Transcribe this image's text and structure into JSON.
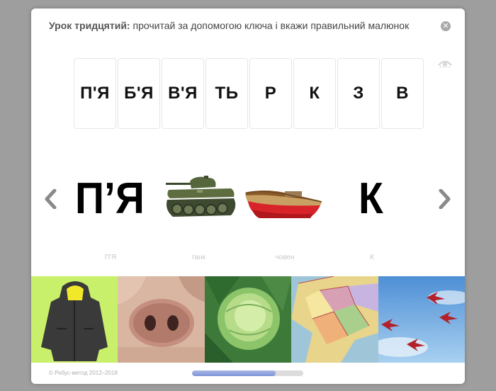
{
  "lesson": {
    "title_bold": "Урок тридцятий:",
    "title_rest": " прочитай за допомогою ключа і вкажи правильний малюнок"
  },
  "icons": {
    "close": "close-icon",
    "eye": "eye-icon",
    "prev": "chevron-left-icon",
    "next": "chevron-right-icon"
  },
  "key_cards": [
    "П'Я",
    "Б'Я",
    "В'Я",
    "ТЬ",
    "Р",
    "К",
    "З",
    "В"
  ],
  "rebus": {
    "first": "П’Я",
    "last": "К",
    "labels": [
      "П'Я",
      "танк",
      "човен",
      "К"
    ]
  },
  "answer_images": [
    "jacket",
    "pig-snout",
    "cabbage",
    "map",
    "fighter-jets"
  ],
  "footer": {
    "copyright": "© Ребус-метод 2012–2018"
  },
  "progress": {
    "fraction": 0.75
  },
  "colors": {
    "accent": "#7d94d6",
    "overlay": "#9e9e9e"
  }
}
